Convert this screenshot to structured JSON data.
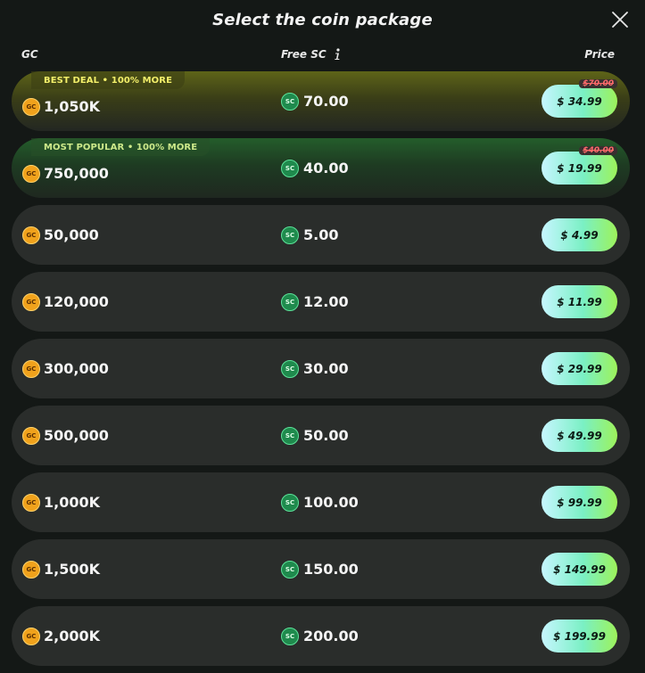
{
  "dialog": {
    "title": "Select the coin package",
    "close_icon": "close-icon"
  },
  "columns": {
    "gc": "GC",
    "free_sc": "Free SC",
    "info_icon": "info-icon",
    "price": "Price"
  },
  "coin_labels": {
    "gc": "GC",
    "sc": "SC"
  },
  "colors": {
    "background": "#141816",
    "row": "#2a2d2b",
    "best_badge": "#f3ef6a",
    "popular_badge": "#cde98a",
    "price_button_start": "#c7f6ff",
    "price_button_end": "#9df25a",
    "old_price": "#ff6b6b"
  },
  "packages": [
    {
      "badge": "BEST DEAL • 100% MORE",
      "variant": "best",
      "gc": "1,050K",
      "sc": "70.00",
      "price": "$ 34.99",
      "old_price": "$70.00"
    },
    {
      "badge": "MOST POPULAR • 100% MORE",
      "variant": "popular",
      "gc": "750,000",
      "sc": "40.00",
      "price": "$ 19.99",
      "old_price": "$40.00"
    },
    {
      "badge": "",
      "variant": "normal",
      "gc": "50,000",
      "sc": "5.00",
      "price": "$ 4.99",
      "old_price": ""
    },
    {
      "badge": "",
      "variant": "normal",
      "gc": "120,000",
      "sc": "12.00",
      "price": "$ 11.99",
      "old_price": ""
    },
    {
      "badge": "",
      "variant": "normal",
      "gc": "300,000",
      "sc": "30.00",
      "price": "$ 29.99",
      "old_price": ""
    },
    {
      "badge": "",
      "variant": "normal",
      "gc": "500,000",
      "sc": "50.00",
      "price": "$ 49.99",
      "old_price": ""
    },
    {
      "badge": "",
      "variant": "normal",
      "gc": "1,000K",
      "sc": "100.00",
      "price": "$ 99.99",
      "old_price": ""
    },
    {
      "badge": "",
      "variant": "normal",
      "gc": "1,500K",
      "sc": "150.00",
      "price": "$ 149.99",
      "old_price": ""
    },
    {
      "badge": "",
      "variant": "normal",
      "gc": "2,000K",
      "sc": "200.00",
      "price": "$ 199.99",
      "old_price": ""
    }
  ]
}
